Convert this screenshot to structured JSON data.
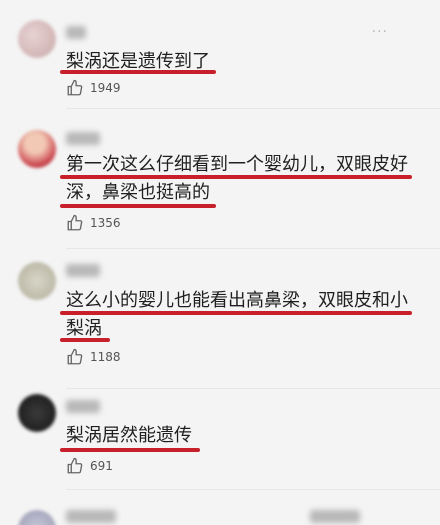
{
  "comments": [
    {
      "text_lines": [
        "梨涡还是遗传到了"
      ],
      "likes": "1949",
      "like_icon": "thumbs-up-icon"
    },
    {
      "text_lines": [
        "第一次这么仔细看到一个婴幼儿，双眼皮好",
        "深，鼻梁也挺高的"
      ],
      "likes": "1356",
      "like_icon": "thumbs-up-icon"
    },
    {
      "text_lines": [
        "这么小的婴儿也能看出高鼻梁，双眼皮和小",
        "梨涡"
      ],
      "likes": "1188",
      "like_icon": "thumbs-up-icon"
    },
    {
      "text_lines": [
        "梨涡居然能遗传"
      ],
      "likes": "691",
      "like_icon": "thumbs-up-icon"
    }
  ],
  "colors": {
    "underline": "#c8202b",
    "background": "#f4f4f4"
  }
}
